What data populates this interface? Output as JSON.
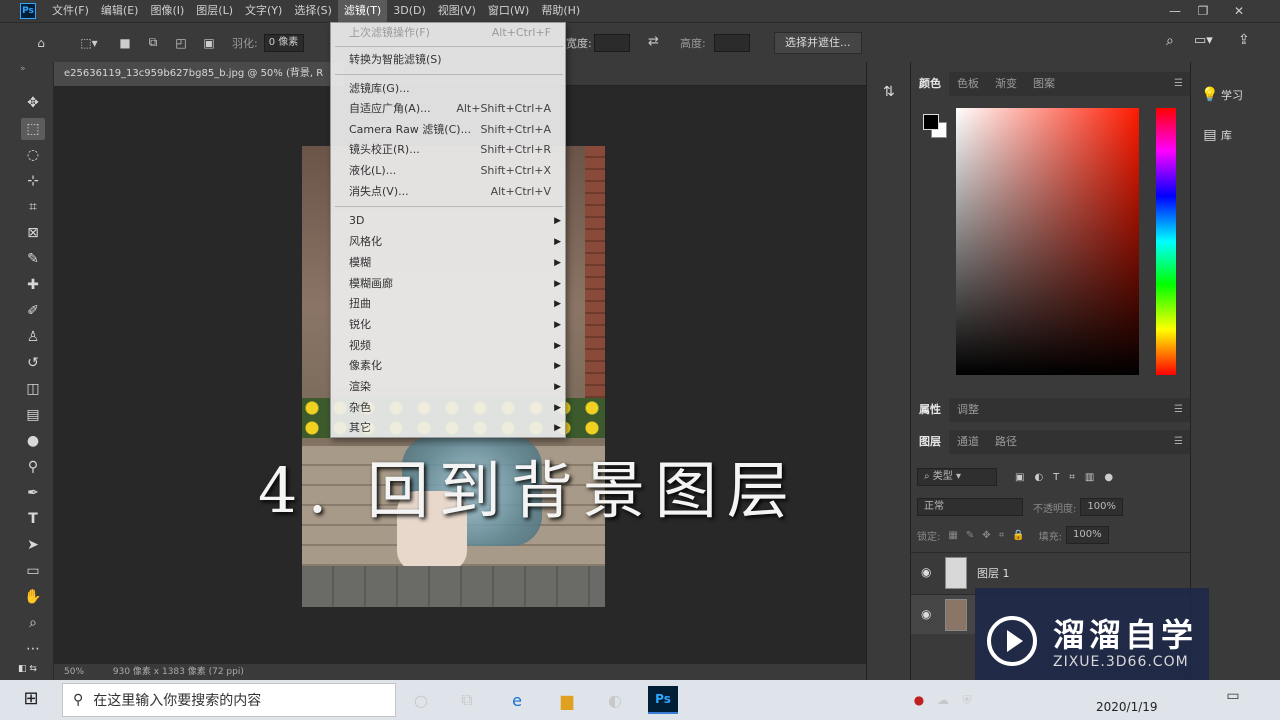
{
  "menubar": {
    "logo": "Ps",
    "items": [
      "文件(F)",
      "编辑(E)",
      "图像(I)",
      "图层(L)",
      "文字(Y)",
      "选择(S)",
      "滤镜(T)",
      "3D(D)",
      "视图(V)",
      "窗口(W)",
      "帮助(H)"
    ],
    "active": "滤镜(T)",
    "window_controls": [
      "minimize",
      "restore",
      "close"
    ]
  },
  "options_bar": {
    "feather_label": "羽化:",
    "feather_value": "0 像素",
    "width_label": "宽度:",
    "height_label": "高度:",
    "select_mask_label": "选择并遮住..."
  },
  "tools": [
    "move-tool",
    "rect-marquee-tool",
    "lasso-tool",
    "quick-select-tool",
    "crop-tool",
    "frame-tool",
    "eyedropper-tool",
    "healing-brush-tool",
    "brush-tool",
    "clone-stamp-tool",
    "history-brush-tool",
    "eraser-tool",
    "gradient-tool",
    "blur-tool",
    "dodge-tool",
    "pen-tool",
    "type-tool",
    "path-select-tool",
    "rectangle-tool",
    "hand-tool",
    "zoom-tool",
    "more-tools"
  ],
  "document": {
    "tab_title": "e25636119_13c959b627bg85_b.jpg @ 50% (背景, R",
    "zoom": "50%",
    "size_info": "930 像素 x 1383 像素 (72 ppi)"
  },
  "caption": "4. 回到背景图层",
  "filter_menu": {
    "items": [
      {
        "label": "上次滤镜操作(F)",
        "shortcut": "Alt+Ctrl+F",
        "disabled": true
      },
      {
        "label": "转换为智能滤镜(S)",
        "shortcut": ""
      },
      {
        "label": "滤镜库(G)...",
        "shortcut": ""
      },
      {
        "label": "自适应广角(A)...",
        "shortcut": "Alt+Shift+Ctrl+A"
      },
      {
        "label": "Camera Raw 滤镜(C)...",
        "shortcut": "Shift+Ctrl+A"
      },
      {
        "label": "镜头校正(R)...",
        "shortcut": "Shift+Ctrl+R"
      },
      {
        "label": "液化(L)...",
        "shortcut": "Shift+Ctrl+X"
      },
      {
        "label": "消失点(V)...",
        "shortcut": "Alt+Ctrl+V"
      },
      {
        "label": "3D",
        "submenu": true
      },
      {
        "label": "风格化",
        "submenu": true
      },
      {
        "label": "模糊",
        "submenu": true
      },
      {
        "label": "模糊画廊",
        "submenu": true
      },
      {
        "label": "扭曲",
        "submenu": true
      },
      {
        "label": "锐化",
        "submenu": true
      },
      {
        "label": "视频",
        "submenu": true
      },
      {
        "label": "像素化",
        "submenu": true
      },
      {
        "label": "渲染",
        "submenu": true
      },
      {
        "label": "杂色",
        "submenu": true
      },
      {
        "label": "其它",
        "submenu": true
      }
    ]
  },
  "panels": {
    "color_tabs": [
      "颜色",
      "色板",
      "渐变",
      "图案"
    ],
    "props_tabs": [
      "属性",
      "调整"
    ],
    "layer_tabs": [
      "图层",
      "通道",
      "路径"
    ],
    "filter_kind": "类型",
    "blend_mode": "正常",
    "opacity_label": "不透明度:",
    "opacity_value": "100%",
    "lock_label": "锁定:",
    "fill_label": "填充:",
    "fill_value": "100%",
    "layers": [
      {
        "name": "图层 1"
      },
      {
        "name": ""
      }
    ]
  },
  "dock": {
    "learn": "学习",
    "libraries": "库"
  },
  "watermark": {
    "title": "溜溜自学",
    "url": "ZIXUE.3D66.COM"
  },
  "taskbar": {
    "search_placeholder": "在这里输入你要搜索的内容",
    "date": "2020/1/19"
  }
}
